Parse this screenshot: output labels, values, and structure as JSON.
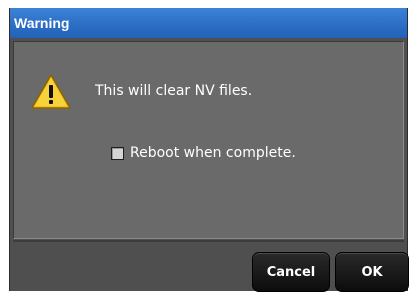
{
  "dialog": {
    "title": "Warning",
    "message": "This will clear NV files.",
    "checkbox": {
      "label": "Reboot when complete.",
      "checked": false
    },
    "buttons": {
      "cancel": "Cancel",
      "ok": "OK"
    },
    "icon": "warning-icon",
    "colors": {
      "titlebar": "#2d6fc5",
      "body": "#6a6a6a",
      "frame": "#4f4f4f",
      "button": "#141414"
    }
  }
}
